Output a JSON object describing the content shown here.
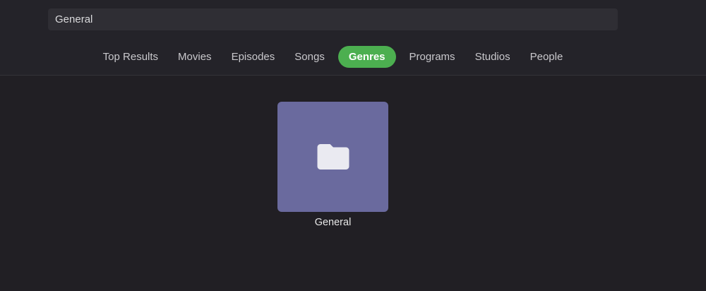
{
  "header": {
    "search": {
      "value": "General"
    }
  },
  "tabs": {
    "active": "Genres",
    "items": [
      {
        "label": "Top Results"
      },
      {
        "label": "Movies"
      },
      {
        "label": "Episodes"
      },
      {
        "label": "Songs"
      },
      {
        "label": "Genres"
      },
      {
        "label": "Programs"
      },
      {
        "label": "Studios"
      },
      {
        "label": "People"
      }
    ]
  },
  "results": {
    "items": [
      {
        "title": "General",
        "icon": "folder-icon"
      }
    ]
  },
  "colors": {
    "accent_green": "#4CAF50",
    "card_purple": "#6A6A9E",
    "header_bg": "#242329",
    "content_bg": "#211F24"
  }
}
